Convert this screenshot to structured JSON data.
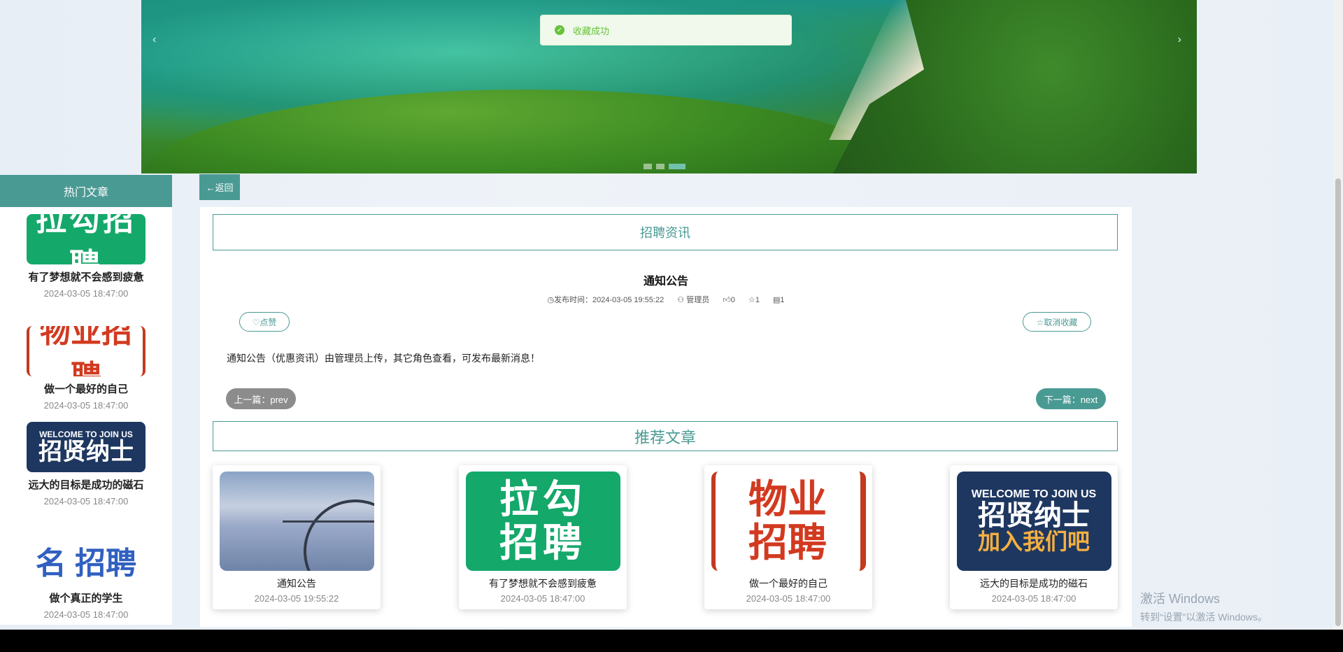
{
  "toast": {
    "message": "收藏成功",
    "icon": "check-circle-icon"
  },
  "banner": {
    "prev": "‹",
    "next": "›",
    "slides": 3,
    "active_slide": 3
  },
  "sidebar": {
    "title": "热门文章",
    "items": [
      {
        "thumb": "拉勾招聘",
        "title": "有了梦想就不会感到疲惫",
        "date": "2024-03-05 18:47:00"
      },
      {
        "thumb": "物业招聘",
        "title": "做一个最好的自己",
        "date": "2024-03-05 18:47:00"
      },
      {
        "thumb_top": "WELCOME TO JOIN US",
        "thumb": "招贤纳士",
        "title": "远大的目标是成功的磁石",
        "date": "2024-03-05 18:47:00"
      },
      {
        "thumb": "名 招聘",
        "title": "做个真正的学生",
        "date": "2024-03-05 18:47:00"
      }
    ]
  },
  "back_button": "←返回",
  "section_title": "招聘资讯",
  "article": {
    "title": "通知公告",
    "publish_label": "发布时间：",
    "publish_time": "2024-03-05 19:55:22",
    "author": "管理员",
    "likes": "0",
    "favorites": "1",
    "comments": "1",
    "like_button": "♡点赞",
    "unfavorite_button": "☆取消收藏",
    "content": "通知公告（优惠资讯）由管理员上传，其它角色查看，可发布最新消息！",
    "prev": "上一篇：prev",
    "next": "下一篇：next"
  },
  "recommended": {
    "title": "推荐文章",
    "items": [
      {
        "title": "通知公告",
        "date": "2024-03-05 19:55:22"
      },
      {
        "thumb_l1": "拉勾",
        "thumb_l2": "招聘",
        "title": "有了梦想就不会感到疲惫",
        "date": "2024-03-05 18:47:00"
      },
      {
        "thumb_l1": "物业",
        "thumb_l2": "招聘",
        "title": "做一个最好的自己",
        "date": "2024-03-05 18:47:00"
      },
      {
        "thumb_top": "WELCOME TO JOIN US",
        "thumb_l1": "招贤纳士",
        "thumb_l2": "加入我们吧",
        "title": "远大的目标是成功的磁石",
        "date": "2024-03-05 18:47:00"
      }
    ]
  },
  "watermark": {
    "line1": "激活 Windows",
    "line2": "转到“设置”以激活 Windows。"
  },
  "colors": {
    "accent": "#4a9a94",
    "prev_pill": "#8c8c8c",
    "toast_green": "#67c23a"
  }
}
